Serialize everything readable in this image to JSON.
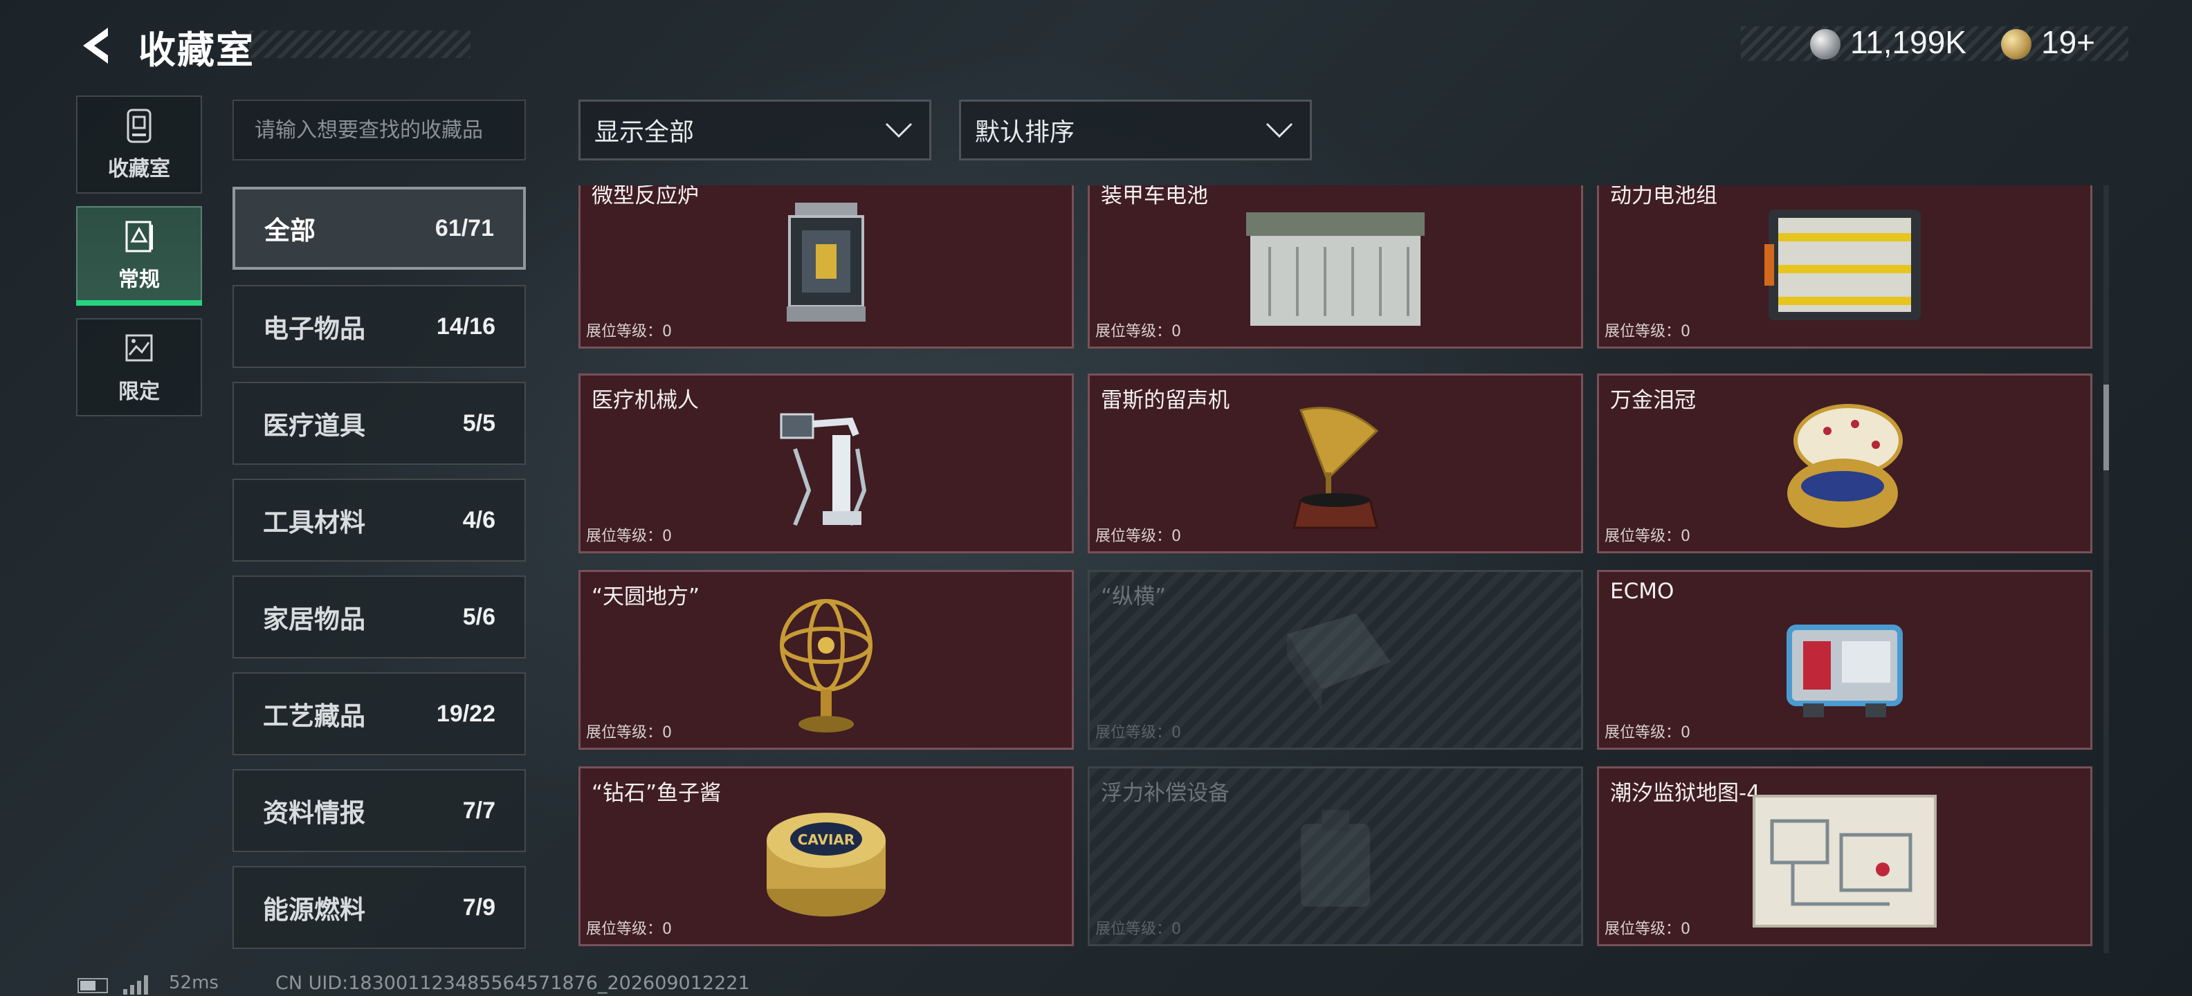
{
  "header": {
    "title": "收藏室",
    "currencies": [
      {
        "icon": "silver-coin-icon",
        "value": "11,199K"
      },
      {
        "icon": "gold-coin-icon",
        "value": "19+"
      }
    ]
  },
  "rail": {
    "items": [
      {
        "label": "收藏室",
        "icon": "collection-room-icon",
        "active": false
      },
      {
        "label": "常规",
        "icon": "regular-icon",
        "active": true
      },
      {
        "label": "限定",
        "icon": "limited-icon",
        "active": false
      }
    ]
  },
  "search": {
    "placeholder": "请输入想要查找的收藏品",
    "value": ""
  },
  "filters": {
    "display": "显示全部",
    "sort": "默认排序"
  },
  "subcategories": [
    {
      "name": "全部",
      "count": "61/71",
      "active": true
    },
    {
      "name": "电子物品",
      "count": "14/16"
    },
    {
      "name": "医疗道具",
      "count": "5/5"
    },
    {
      "name": "工具材料",
      "count": "4/6"
    },
    {
      "name": "家居物品",
      "count": "5/6"
    },
    {
      "name": "工艺藏品",
      "count": "19/22"
    },
    {
      "name": "资料情报",
      "count": "7/7"
    },
    {
      "name": "能源燃料",
      "count": "7/9"
    }
  ],
  "items": [
    {
      "name": "微型反应炉",
      "level": "展位等级：0",
      "locked": false,
      "icon": "micro-reactor-icon"
    },
    {
      "name": "装甲车电池",
      "level": "展位等级：0",
      "locked": false,
      "icon": "armored-battery-icon"
    },
    {
      "name": "动力电池组",
      "level": "展位等级：0",
      "locked": false,
      "icon": "power-battery-pack-icon"
    },
    {
      "name": "医疗机械人",
      "level": "展位等级：0",
      "locked": false,
      "icon": "medical-robot-icon"
    },
    {
      "name": "雷斯的留声机",
      "level": "展位等级：0",
      "locked": false,
      "icon": "gramophone-icon"
    },
    {
      "name": "万金泪冠",
      "level": "展位等级：0",
      "locked": false,
      "icon": "jeweled-egg-icon"
    },
    {
      "name": "“天圆地方”",
      "level": "展位等级：0",
      "locked": false,
      "icon": "armillary-sphere-icon"
    },
    {
      "name": "“纵横”",
      "level": "展位等级：0",
      "locked": true,
      "icon": "chessboard-icon"
    },
    {
      "name": "ECMO",
      "level": "展位等级：0",
      "locked": false,
      "icon": "ecmo-machine-icon"
    },
    {
      "name": "“钻石”鱼子酱",
      "level": "展位等级：0",
      "locked": false,
      "icon": "caviar-tin-icon"
    },
    {
      "name": "浮力补偿设备",
      "level": "展位等级：0",
      "locked": true,
      "icon": "buoyancy-device-icon"
    },
    {
      "name": "潮汐监狱地图-4",
      "level": "展位等级：0",
      "locked": false,
      "icon": "prison-map-icon"
    }
  ],
  "caviar_label": "CAVIAR",
  "footer": {
    "latency": "52ms",
    "uid": "CN UID:1830011234855645718​76_202609012221"
  },
  "colors": {
    "accent": "#27d480",
    "card_bg": "#3f1d23",
    "card_border": "#7a5058"
  }
}
